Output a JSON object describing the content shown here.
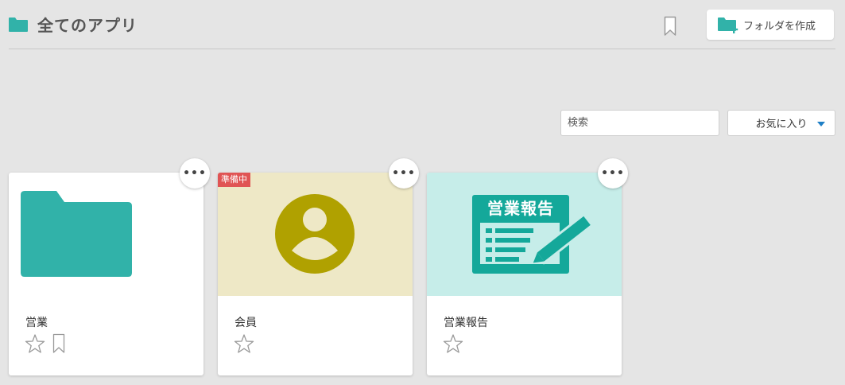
{
  "header": {
    "title": "全てのアプリ",
    "create_folder_label": "フォルダを作成"
  },
  "toolbar": {
    "search_placeholder": "検索",
    "sort_selected": "お気に入り"
  },
  "cards": [
    {
      "name": "営業",
      "type": "folder",
      "starred": false
    },
    {
      "name": "会員",
      "type": "app",
      "status_badge": "準備中",
      "starred": false
    },
    {
      "name": "営業報告",
      "type": "app",
      "thumb_text": "営業報告",
      "starred": false
    }
  ],
  "colors": {
    "background": "#e5e5e5",
    "folder_teal": "#31b2a9",
    "member_bg": "#eee8c6",
    "member_icon": "#b0a100",
    "report_bg": "#c6ede9",
    "report_icon": "#14a89a",
    "badge_red": "#e05454"
  }
}
